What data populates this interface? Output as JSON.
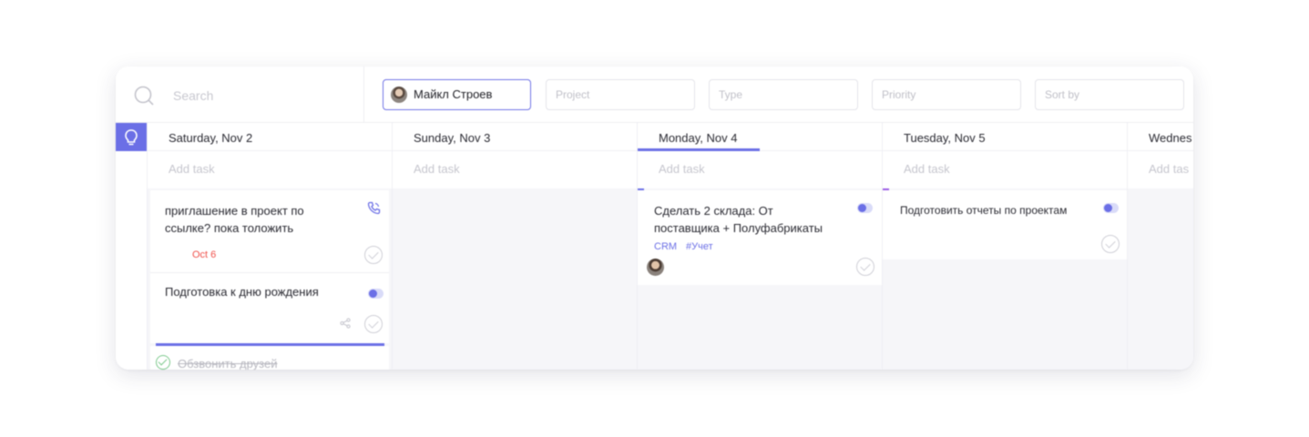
{
  "search": {
    "placeholder": "Search"
  },
  "filters": {
    "user": "Майкл Строев",
    "project": "Project",
    "type": "Type",
    "priority": "Priority",
    "sort_by": "Sort by"
  },
  "columns": [
    {
      "title": "Saturday, Nov 2",
      "add_task": "Add task"
    },
    {
      "title": "Sunday, Nov 3",
      "add_task": "Add task"
    },
    {
      "title": "Monday, Nov 4",
      "add_task": "Add task"
    },
    {
      "title": "Tuesday, Nov 5",
      "add_task": "Add task"
    },
    {
      "title": "Wednes",
      "add_task": "Add tas"
    }
  ],
  "tasks": {
    "sat_1": {
      "text": "приглашение в проект по ссылке? пока толожить",
      "date": "Oct 6"
    },
    "sat_2": {
      "text": "Подготовка к дню рождения"
    },
    "sat_done": {
      "text": "Обзвонить друзей"
    },
    "mon_1": {
      "text": "Сделать 2 склада: От поставщика + Полуфабрикаты",
      "tags": [
        "CRM",
        "#Учет"
      ]
    },
    "tue_1": {
      "text": "Подготовить отчеты по проектам"
    }
  },
  "colors": {
    "accent": "#6b6fe6",
    "overdue": "#f0504a",
    "purple_marker": "#9b5de5",
    "done_green": "#7cc98c"
  },
  "icons": [
    "search-icon",
    "lightbulb-icon",
    "phone-icon",
    "toggle-icon",
    "check-circle-icon",
    "share-icon"
  ]
}
